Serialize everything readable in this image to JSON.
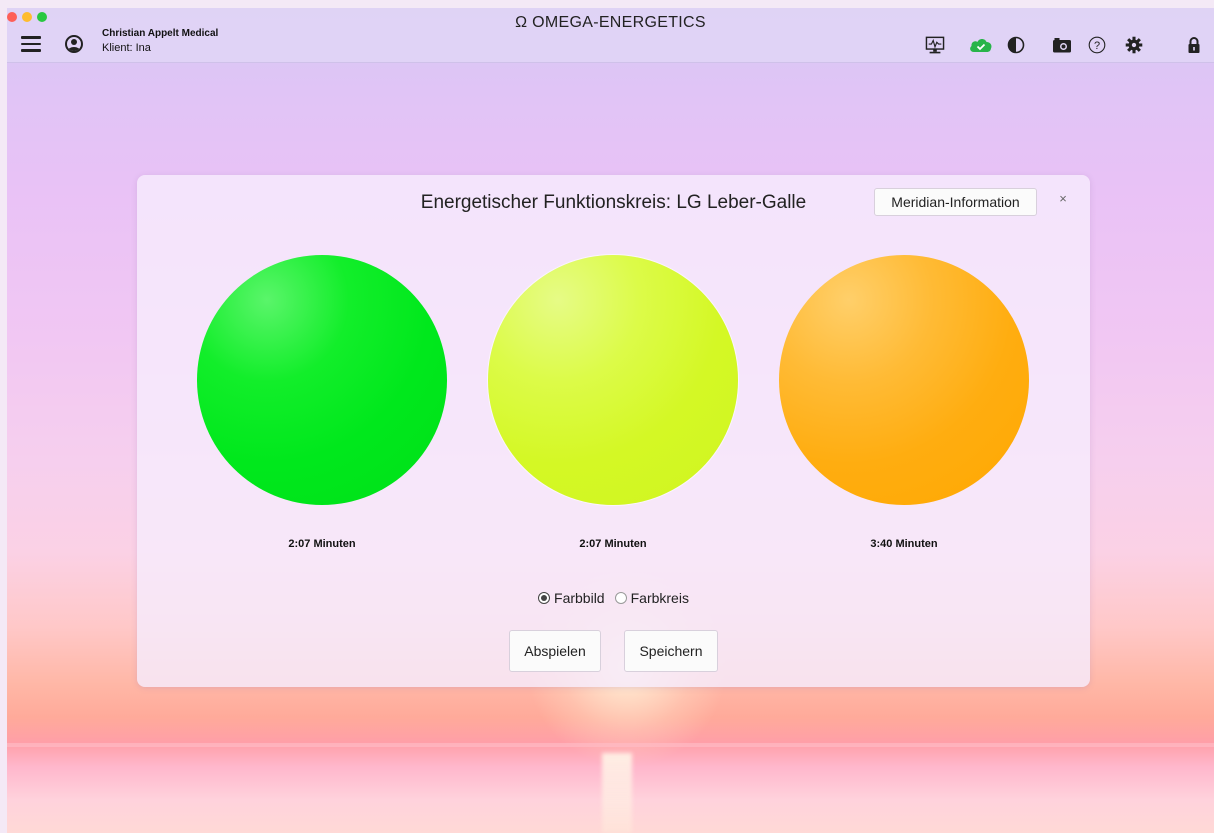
{
  "app": {
    "title": "Ω OMEGA-ENERGETICS",
    "company": "Christian Appelt Medical",
    "client": "Klient: Ina"
  },
  "toolbar": {
    "icons": [
      "monitor-icon",
      "cloud-check-icon",
      "contrast-icon",
      "camera-icon",
      "help-icon",
      "gear-icon",
      "lock-icon"
    ],
    "cloud_color": "#28b44a"
  },
  "dialog": {
    "title": "Energetischer Funktionskreis: LG Leber-Galle",
    "meridian_button": "Meridian-Information",
    "close_label": "×",
    "colors": [
      {
        "hex": "#00e81c",
        "duration": "2:07 Minuten"
      },
      {
        "hex": "#d4f825",
        "duration": "2:07 Minuten"
      },
      {
        "hex": "#ffad10",
        "duration": "3:40 Minuten"
      }
    ],
    "display_mode": {
      "options": [
        "Farbbild",
        "Farbkreis"
      ],
      "selected": "Farbbild"
    },
    "play_button": "Abspielen",
    "save_button": "Speichern"
  }
}
